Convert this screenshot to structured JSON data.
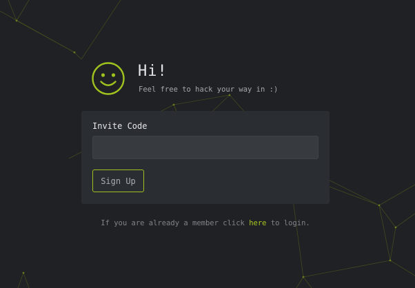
{
  "hero": {
    "title": "Hi!",
    "subtitle": "Feel free to hack your way in :)",
    "icon": "smiley-icon"
  },
  "form": {
    "invite_label": "Invite Code",
    "invite_value": "",
    "invite_placeholder": "",
    "signup_label": "Sign Up"
  },
  "footer": {
    "prefix": "If you are already a member click",
    "link_label": "here",
    "suffix": "to login."
  },
  "colors": {
    "background": "#1f2124",
    "card": "#2a2d31",
    "input": "#373b40",
    "accent": "#9fc21f",
    "text": "#e4e6e8",
    "muted": "#7f848a"
  }
}
